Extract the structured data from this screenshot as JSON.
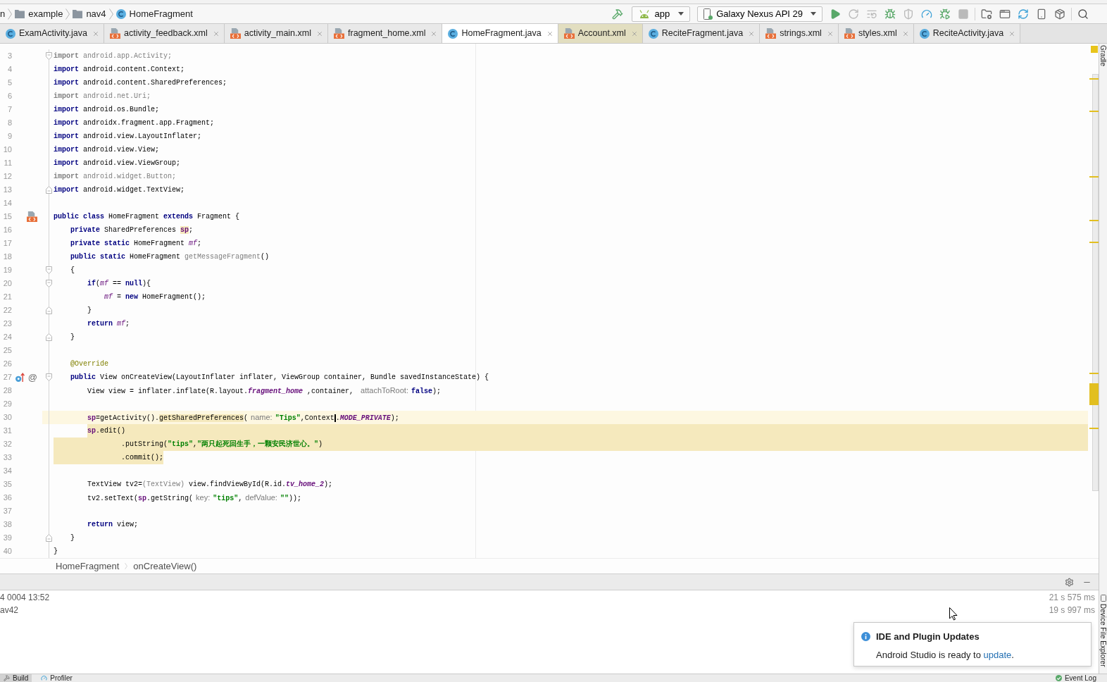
{
  "nav_bar": {
    "crumbs": [
      {
        "label": "n",
        "kind": "text"
      },
      {
        "label": "example",
        "kind": "folder"
      },
      {
        "label": "nav4",
        "kind": "folder"
      },
      {
        "label": "HomeFragment",
        "kind": "class"
      }
    ]
  },
  "toolbar": {
    "leading_actions": [
      {
        "kind": "build",
        "disabled": false
      }
    ],
    "module": "app",
    "device": "Galaxy Nexus API 29",
    "actions": [
      {
        "kind": "run",
        "disabled": false
      },
      {
        "kind": "apply_changes",
        "disabled": true
      },
      {
        "kind": "apply_code",
        "disabled": true
      },
      {
        "kind": "debug",
        "disabled": false
      },
      {
        "kind": "coverage",
        "disabled": true
      },
      {
        "kind": "profile",
        "disabled": false
      },
      {
        "kind": "attach_debugger",
        "disabled": false
      },
      {
        "kind": "stop",
        "disabled": true
      },
      {
        "kind": "separator"
      },
      {
        "kind": "project_structure",
        "disabled": false
      },
      {
        "kind": "layout_inspector",
        "disabled": false
      },
      {
        "kind": "sync",
        "disabled": false
      },
      {
        "kind": "avd_manager",
        "disabled": false
      },
      {
        "kind": "sdk_manager",
        "disabled": false
      },
      {
        "kind": "separator"
      },
      {
        "kind": "search",
        "disabled": false
      }
    ]
  },
  "tabs": [
    {
      "label": "ExamActivity.java",
      "kind": "java",
      "selected": false
    },
    {
      "label": "activity_feedback.xml",
      "kind": "xml",
      "selected": false
    },
    {
      "label": "activity_main.xml",
      "kind": "xml",
      "selected": false
    },
    {
      "label": "fragment_home.xml",
      "kind": "xml",
      "selected": false
    },
    {
      "label": "HomeFragment.java",
      "kind": "java",
      "selected": true
    },
    {
      "label": "Account.xml",
      "kind": "xml",
      "selected": false,
      "color": "#e2dec0"
    },
    {
      "label": "ReciteFragment.java",
      "kind": "java",
      "selected": false
    },
    {
      "label": "strings.xml",
      "kind": "xml",
      "selected": false
    },
    {
      "label": "styles.xml",
      "kind": "xml",
      "selected": false
    },
    {
      "label": "ReciteActivity.java",
      "kind": "java",
      "selected": false
    }
  ],
  "editor": {
    "lines": [
      {
        "n": "3",
        "current": false,
        "fold": {
          "kind": "open"
        },
        "tokens": [
          {
            "text": "import",
            "kind": "unused_keyword"
          },
          {
            "text": " android.app.Activity;",
            "kind": "unused"
          }
        ]
      },
      {
        "n": "4",
        "current": false,
        "tokens": [
          {
            "text": "import",
            "kind": "keyword"
          },
          {
            "text": " android.content.Context;",
            "kind": "plain"
          }
        ]
      },
      {
        "n": "5",
        "current": false,
        "tokens": [
          {
            "text": "import",
            "kind": "keyword"
          },
          {
            "text": " android.content.SharedPreferences;",
            "kind": "plain"
          }
        ]
      },
      {
        "n": "6",
        "current": false,
        "tokens": [
          {
            "text": "import",
            "kind": "unused_keyword"
          },
          {
            "text": " android.net.Uri;",
            "kind": "unused"
          }
        ]
      },
      {
        "n": "7",
        "current": false,
        "tokens": [
          {
            "text": "import",
            "kind": "keyword"
          },
          {
            "text": " android.os.Bundle;",
            "kind": "plain"
          }
        ]
      },
      {
        "n": "8",
        "current": false,
        "tokens": [
          {
            "text": "import",
            "kind": "keyword"
          },
          {
            "text": " androidx.fragment.app.Fragment;",
            "kind": "plain"
          }
        ]
      },
      {
        "n": "9",
        "current": false,
        "tokens": [
          {
            "text": "import",
            "kind": "keyword"
          },
          {
            "text": " android.view.LayoutInflater;",
            "kind": "plain"
          }
        ]
      },
      {
        "n": "10",
        "current": false,
        "tokens": [
          {
            "text": "import",
            "kind": "keyword"
          },
          {
            "text": " android.view.View;",
            "kind": "plain"
          }
        ]
      },
      {
        "n": "11",
        "current": false,
        "tokens": [
          {
            "text": "import",
            "kind": "keyword"
          },
          {
            "text": " android.view.ViewGroup;",
            "kind": "plain"
          }
        ]
      },
      {
        "n": "12",
        "current": false,
        "tokens": [
          {
            "text": "import",
            "kind": "unused_keyword"
          },
          {
            "text": " android.widget.Button;",
            "kind": "unused"
          }
        ]
      },
      {
        "n": "13",
        "current": false,
        "fold": {
          "kind": "close"
        },
        "tokens": [
          {
            "text": "import",
            "kind": "keyword"
          },
          {
            "text": " android.widget.TextView;",
            "kind": "plain"
          }
        ]
      },
      {
        "n": "14",
        "current": false
      },
      {
        "n": "15",
        "current": false,
        "gutter": [
          {
            "kind": "layout"
          }
        ],
        "tokens": [
          {
            "text": "public class",
            "kind": "keyword"
          },
          {
            "text": " HomeFragment ",
            "kind": "plain"
          },
          {
            "text": "extends",
            "kind": "keyword"
          },
          {
            "text": " Fragment {",
            "kind": "plain"
          }
        ]
      },
      {
        "n": "16",
        "current": false,
        "tokens": [
          {
            "text": "    private",
            "kind": "keyword"
          },
          {
            "text": " SharedPreferences ",
            "kind": "plain"
          },
          {
            "text": "sp",
            "kind": "field",
            "marked": true
          },
          {
            "text": ";",
            "kind": "plain"
          }
        ]
      },
      {
        "n": "17",
        "current": false,
        "tokens": [
          {
            "text": "    private static",
            "kind": "keyword"
          },
          {
            "text": " HomeFragment ",
            "kind": "plain"
          },
          {
            "text": "mf",
            "kind": "static"
          },
          {
            "text": ";",
            "kind": "plain"
          }
        ]
      },
      {
        "n": "18",
        "current": false,
        "tokens": [
          {
            "text": "    public static",
            "kind": "keyword"
          },
          {
            "text": " HomeFragment ",
            "kind": "plain"
          },
          {
            "text": "getMessageFragment",
            "kind": "unused"
          },
          {
            "text": "()",
            "kind": "plain"
          }
        ]
      },
      {
        "n": "19",
        "current": false,
        "fold": {
          "kind": "open"
        },
        "tokens": [
          {
            "text": "    {",
            "kind": "plain"
          }
        ]
      },
      {
        "n": "20",
        "current": false,
        "fold": {
          "kind": "open"
        },
        "tokens": [
          {
            "text": "        if",
            "kind": "keyword"
          },
          {
            "text": "(",
            "kind": "plain"
          },
          {
            "text": "mf",
            "kind": "static"
          },
          {
            "text": " == ",
            "kind": "plain"
          },
          {
            "text": "null",
            "kind": "keyword"
          },
          {
            "text": "){",
            "kind": "plain"
          }
        ]
      },
      {
        "n": "21",
        "current": false,
        "tokens": [
          {
            "text": "            mf",
            "kind": "static"
          },
          {
            "text": " = ",
            "kind": "plain"
          },
          {
            "text": "new",
            "kind": "keyword"
          },
          {
            "text": " HomeFragment();",
            "kind": "plain"
          }
        ]
      },
      {
        "n": "22",
        "current": false,
        "fold": {
          "kind": "close"
        },
        "tokens": [
          {
            "text": "        }",
            "kind": "plain"
          }
        ]
      },
      {
        "n": "23",
        "current": false,
        "tokens": [
          {
            "text": "        return",
            "kind": "keyword"
          },
          {
            "text": " mf",
            "kind": "static"
          },
          {
            "text": ";",
            "kind": "plain"
          }
        ]
      },
      {
        "n": "24",
        "current": false,
        "fold": {
          "kind": "close"
        },
        "tokens": [
          {
            "text": "    }",
            "kind": "plain"
          }
        ]
      },
      {
        "n": "25",
        "current": false
      },
      {
        "n": "26",
        "current": false,
        "tokens": [
          {
            "text": "    @Override",
            "kind": "annotation"
          }
        ]
      },
      {
        "n": "27",
        "current": false,
        "fold": {
          "kind": "open"
        },
        "gutter": [
          {
            "kind": "override"
          },
          {
            "kind": "glyph",
            "text": "@"
          }
        ],
        "tokens": [
          {
            "text": "    public",
            "kind": "keyword"
          },
          {
            "text": " View onCreateView(LayoutInflater inflater, ViewGroup container, Bundle savedInstanceState) {",
            "kind": "plain"
          }
        ]
      },
      {
        "n": "28",
        "current": false,
        "tokens": [
          {
            "text": "        View view = inflater.inflate(R.layout.",
            "kind": "plain"
          },
          {
            "text": "fragment_home",
            "kind": "constant"
          },
          {
            "text": " ,container, ",
            "kind": "plain"
          },
          {
            "text": "attachToRoot:",
            "kind": "hint"
          },
          {
            "text": "false",
            "kind": "keyword"
          },
          {
            "text": ");",
            "kind": "plain"
          }
        ]
      },
      {
        "n": "29",
        "current": false
      },
      {
        "n": "30",
        "current": true,
        "tokens": [
          {
            "text": "        sp",
            "kind": "field"
          },
          {
            "text": "=getActivity().",
            "kind": "plain"
          },
          {
            "text": "getSharedPreferences",
            "kind": "plain",
            "marked": true
          },
          {
            "text": "(",
            "kind": "plain"
          },
          {
            "text": "name:",
            "kind": "hint"
          },
          {
            "text": "\"Tips\"",
            "kind": "string"
          },
          {
            "text": ",Context",
            "kind": "plain",
            "caret": true
          },
          {
            "text": ".",
            "kind": "plain"
          },
          {
            "text": "MODE_PRIVATE",
            "kind": "constant"
          },
          {
            "text": ");",
            "kind": "plain"
          }
        ]
      },
      {
        "n": "31",
        "current": false,
        "band": {
          "kind": "rest"
        },
        "tokens": [
          {
            "text": "        sp",
            "kind": "field"
          },
          {
            "text": ".edit()",
            "kind": "plain"
          }
        ]
      },
      {
        "n": "32",
        "current": false,
        "band": {
          "kind": "full"
        },
        "tokens": [
          {
            "text": "                .putString(",
            "kind": "plain"
          },
          {
            "text": "\"tips\"",
            "kind": "string"
          },
          {
            "text": ",",
            "kind": "plain"
          },
          {
            "text": "\"两只起死回生手，一颗安民济世心。\"",
            "kind": "string"
          },
          {
            "text": ")",
            "kind": "plain"
          }
        ]
      },
      {
        "n": "33",
        "current": false,
        "band": {
          "kind": "lead"
        },
        "tokens": [
          {
            "text": "                .commit();",
            "kind": "plain"
          }
        ]
      },
      {
        "n": "34",
        "current": false
      },
      {
        "n": "35",
        "current": false,
        "tokens": [
          {
            "text": "        TextView tv2=",
            "kind": "plain"
          },
          {
            "text": "(TextView)",
            "kind": "unused"
          },
          {
            "text": " view.findViewById(R.id.",
            "kind": "plain"
          },
          {
            "text": "tv_home_2",
            "kind": "constant"
          },
          {
            "text": ");",
            "kind": "plain"
          }
        ]
      },
      {
        "n": "36",
        "current": false,
        "tokens": [
          {
            "text": "        tv2.setText(",
            "kind": "plain"
          },
          {
            "text": "sp",
            "kind": "field"
          },
          {
            "text": ".getString(",
            "kind": "plain"
          },
          {
            "text": "key:",
            "kind": "hint"
          },
          {
            "text": "\"tips\"",
            "kind": "string"
          },
          {
            "text": ",",
            "kind": "plain"
          },
          {
            "text": "defValue:",
            "kind": "hint"
          },
          {
            "text": "\"\"",
            "kind": "string"
          },
          {
            "text": "));",
            "kind": "plain"
          }
        ]
      },
      {
        "n": "37",
        "current": false
      },
      {
        "n": "38",
        "current": false,
        "tokens": [
          {
            "text": "        return",
            "kind": "keyword"
          },
          {
            "text": " view;",
            "kind": "plain"
          }
        ]
      },
      {
        "n": "39",
        "current": false,
        "fold": {
          "kind": "close"
        },
        "tokens": [
          {
            "text": "    }",
            "kind": "plain"
          }
        ]
      },
      {
        "n": "40",
        "current": false,
        "tokens": [
          {
            "text": "}",
            "kind": "plain"
          }
        ]
      }
    ]
  },
  "breadcrumb": [
    {
      "label": "HomeFragment"
    },
    {
      "label": "onCreateView()"
    }
  ],
  "build_output": [
    {
      "text": "4 0004 13:52",
      "duration": "21 s 575 ms"
    },
    {
      "text": "av42",
      "duration": "19 s 997 ms"
    }
  ],
  "notification": {
    "title": "IDE and Plugin Updates",
    "text_before": "Android Studio is ready to ",
    "link": "update",
    "text_after": "."
  },
  "right_strip": {
    "top": "Gradle",
    "bottom": "Device File Explorer"
  },
  "bottom_bar": {
    "tabs": [
      {
        "label": "Build",
        "kind": "build",
        "selected": true
      },
      {
        "label": "Profiler",
        "kind": "profiler",
        "selected": false
      }
    ],
    "right": [
      {
        "label": "Event Log",
        "kind": "event_log"
      }
    ]
  }
}
